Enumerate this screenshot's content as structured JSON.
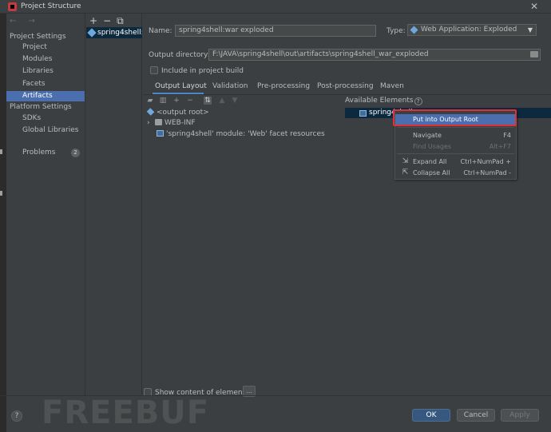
{
  "window": {
    "title": "Project Structure",
    "close": "✕"
  },
  "sidebar": {
    "nav_arrows": "← →",
    "section_project": "Project Settings",
    "items_project": [
      {
        "label": "Project"
      },
      {
        "label": "Modules"
      },
      {
        "label": "Libraries"
      },
      {
        "label": "Facets"
      },
      {
        "label": "Artifacts",
        "selected": true
      }
    ],
    "section_platform": "Platform Settings",
    "items_platform": [
      {
        "label": "SDKs"
      },
      {
        "label": "Global Libraries"
      }
    ],
    "problems": {
      "label": "Problems",
      "count": "2"
    }
  },
  "artifacts": {
    "tools": {
      "add": "+",
      "remove": "−",
      "copy": "⧉"
    },
    "list": [
      {
        "label": "spring4shell:war exploded"
      }
    ]
  },
  "form": {
    "name_label": "Name:",
    "name_value": "spring4shell:war exploded",
    "type_label": "Type:",
    "type_value": "Web Application: Exploded",
    "output_label": "Output directory:",
    "output_value": "F:\\JAVA\\spring4shell\\out\\artifacts\\spring4shell_war_exploded",
    "include_label": "Include in project build",
    "include_checked": false
  },
  "tabs": [
    {
      "label": "Output Layout",
      "active": true
    },
    {
      "label": "Validation"
    },
    {
      "label": "Pre-processing"
    },
    {
      "label": "Post-processing"
    },
    {
      "label": "Maven"
    }
  ],
  "layout_tree": [
    {
      "label": "<output root>",
      "icon": "output-root-icon"
    },
    {
      "label": "WEB-INF",
      "icon": "folder-icon",
      "expandable": true
    },
    {
      "label": "'spring4shell' module: 'Web' facet resources",
      "icon": "module-icon"
    }
  ],
  "available": {
    "title": "Available Elements",
    "help": "?",
    "items": [
      {
        "label": "spring4shell"
      }
    ]
  },
  "context_menu": {
    "items": [
      {
        "label": "Put into Output Root",
        "shortcut": "",
        "highlighted": true
      },
      {
        "label": "Navigate",
        "shortcut": "F4"
      },
      {
        "label": "Find Usages",
        "shortcut": "Alt+F7",
        "disabled": true
      },
      {
        "label": "Expand All",
        "shortcut": "Ctrl+NumPad +"
      },
      {
        "label": "Collapse All",
        "shortcut": "Ctrl+NumPad -"
      }
    ]
  },
  "footer": {
    "show_content_label": "Show content of elements",
    "ellipsis": "...",
    "help": "?",
    "ok": "OK",
    "cancel": "Cancel",
    "apply": "Apply"
  },
  "watermark": "FREEBUF",
  "colors": {
    "background": "#3c3f41",
    "selection": "#4b6eaf",
    "selection_inactive": "#0d293e",
    "highlight_box": "#e0303a",
    "primary_button": "#365880"
  }
}
